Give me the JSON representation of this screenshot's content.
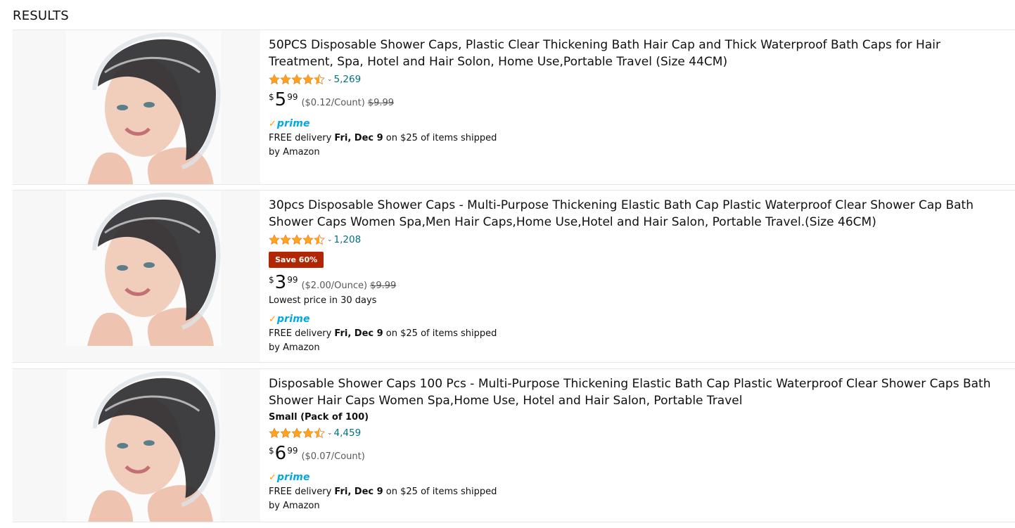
{
  "heading": "RESULTS",
  "products": [
    {
      "title": "50PCS Disposable Shower Caps, Plastic Clear Thickening Bath Hair Cap and Thick Waterproof Bath Caps for Hair Treatment, Spa, Hotel and Hair Solon, Home Use,Portable Travel (Size 44CM)",
      "rating": 4.5,
      "review_count": "5,269",
      "price_symbol": "$",
      "price_whole": "5",
      "price_fraction": "99",
      "unit_price": "($0.12/Count)",
      "list_price": "$9.99",
      "prime_label": "prime",
      "delivery_prefix": "FREE delivery ",
      "delivery_date": "Fri, Dec 9",
      "delivery_suffix": " on $25 of items shipped by Amazon"
    },
    {
      "title": "30pcs Disposable Shower Caps - Multi-Purpose Thickening Elastic Bath Cap Plastic Waterproof Clear Shower Cap Bath Shower Caps Women Spa,Men Hair Caps,Home Use,Hotel and Hair Salon, Portable Travel.(Size 46CM)",
      "rating": 4.5,
      "review_count": "1,208",
      "save_badge": "Save 60%",
      "price_symbol": "$",
      "price_whole": "3",
      "price_fraction": "99",
      "unit_price": "($2.00/Ounce)",
      "list_price": "$9.99",
      "lowest_price_note": "Lowest price in 30 days",
      "prime_label": "prime",
      "delivery_prefix": "FREE delivery ",
      "delivery_date": "Fri, Dec 9",
      "delivery_suffix": " on $25 of items shipped by Amazon"
    },
    {
      "title": "Disposable Shower Caps 100 Pcs - Multi-Purpose Thickening Elastic Bath Cap Plastic Waterproof Clear Shower Caps Bath Shower Hair Caps Women Spa,Home Use, Hotel and Hair Salon, Portable Travel",
      "variant": "Small (Pack of 100)",
      "rating": 4.5,
      "review_count": "4,459",
      "price_symbol": "$",
      "price_whole": "6",
      "price_fraction": "99",
      "unit_price": "($0.07/Count)",
      "prime_label": "prime",
      "delivery_prefix": "FREE delivery ",
      "delivery_date": "Fri, Dec 9",
      "delivery_suffix": " on $25 of items shipped by Amazon"
    }
  ],
  "colors": {
    "star": "#ffa41c",
    "link": "#007185",
    "badge": "#b12704",
    "prime_blue": "#00a8e1",
    "prime_check": "#ff9900"
  },
  "icons": {
    "star": "star-icon",
    "half_star": "half-star-icon",
    "chevron": "chevron-down-icon",
    "prime": "prime-check-icon"
  }
}
